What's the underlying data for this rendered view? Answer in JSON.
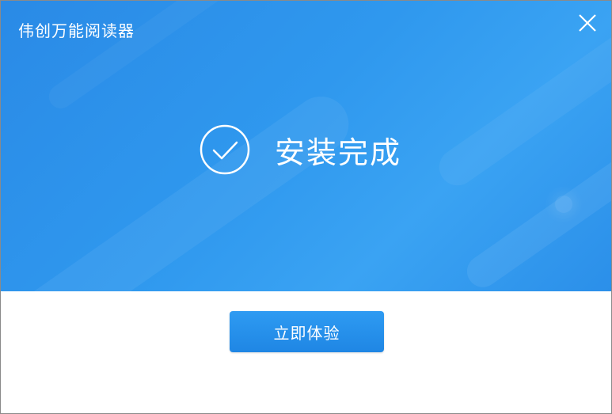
{
  "window": {
    "title": "伟创万能阅读器",
    "close_icon": "close-icon"
  },
  "main": {
    "status_icon": "check-circle-icon",
    "status_text": "安装完成"
  },
  "footer": {
    "primary_button_label": "立即体验"
  },
  "colors": {
    "banner_blue": "#2f98ee",
    "button_blue": "#2490ea",
    "text_white": "#ffffff",
    "background": "#ffffff"
  }
}
